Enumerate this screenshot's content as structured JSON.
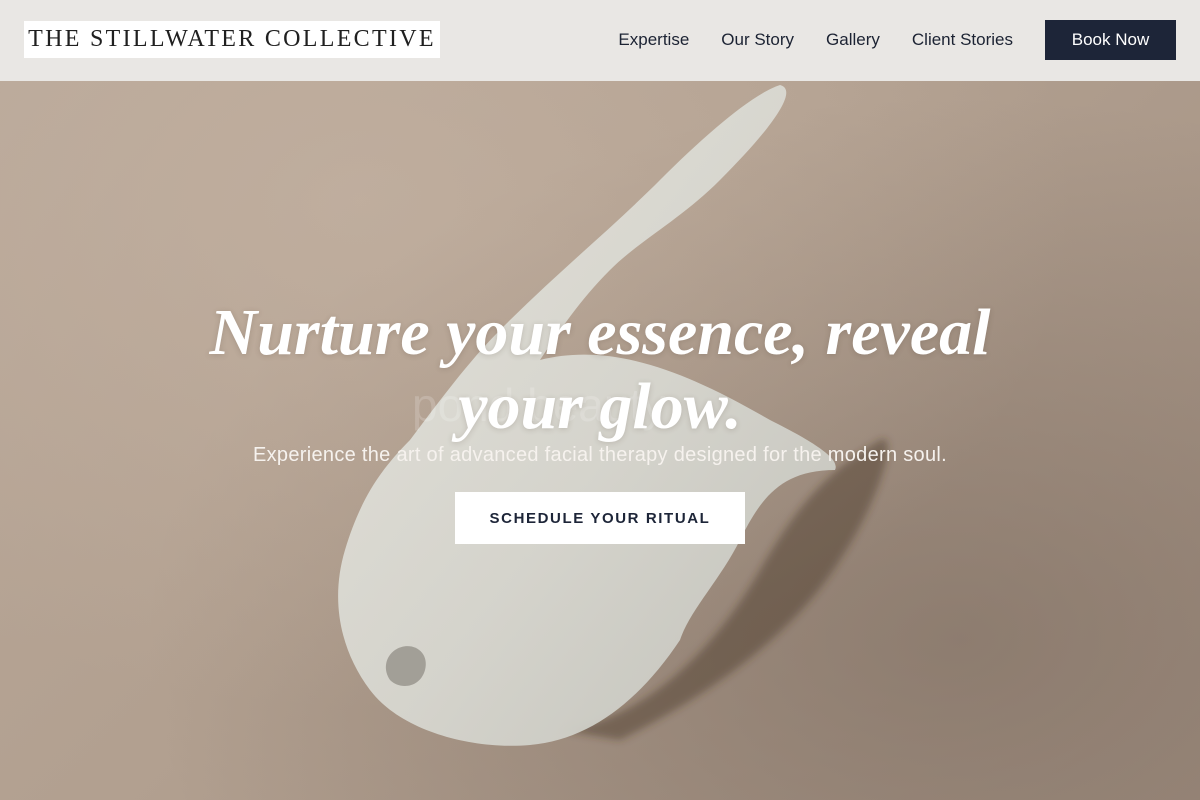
{
  "header": {
    "logo_text": "THE STILLWATER COLLECTIVE",
    "nav_links": [
      "Expertise",
      "Our Story",
      "Gallery",
      "Client Stories"
    ],
    "book_button": "Book Now"
  },
  "hero": {
    "headline": "Nurture your essence, reveal your glow.",
    "subheadline": "Experience the art of advanced facial therapy designed for the modern soul.",
    "cta_label": "SCHEDULE YOUR RITUAL",
    "background_watermark": "pond beauty"
  },
  "colors": {
    "header_bg": "#e9e7e4",
    "accent_navy": "#1d2538",
    "hero_bg": "#b3a193",
    "cream_smear": "#dcdcd5",
    "white": "#ffffff"
  }
}
